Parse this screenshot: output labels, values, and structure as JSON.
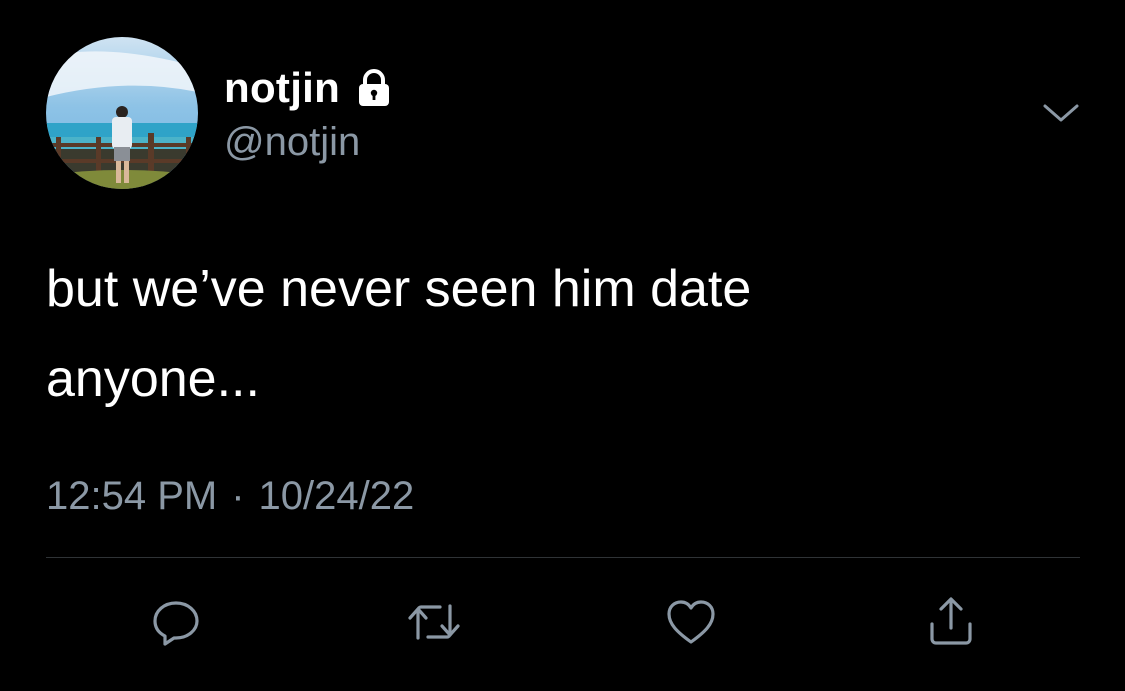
{
  "user": {
    "display_name": "notjin",
    "handle": "@notjin",
    "protected_icon": "lock-icon"
  },
  "tweet": {
    "text": "but we’ve never seen him date\nanyone...",
    "time": "12:54 PM",
    "separator": "·",
    "date": "10/24/22"
  },
  "actions": [
    {
      "name": "reply",
      "icon": "reply-icon"
    },
    {
      "name": "retweet",
      "icon": "retweet-icon"
    },
    {
      "name": "like",
      "icon": "heart-icon"
    },
    {
      "name": "share",
      "icon": "share-icon"
    }
  ],
  "colors": {
    "background": "#000000",
    "text_primary": "#ffffff",
    "text_secondary": "#8b98a5",
    "divider": "#2f3336"
  }
}
